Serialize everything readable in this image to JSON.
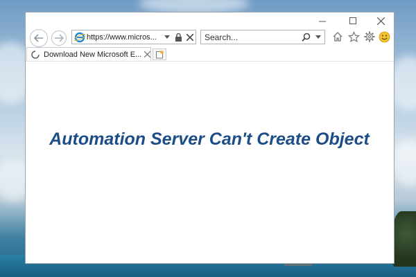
{
  "browser": {
    "address_url": "https://www.micros...",
    "search_placeholder": "Search...",
    "tab_title": "Download New Microsoft E..."
  },
  "content": {
    "headline": "Automation Server Can't Create Object"
  },
  "icons": [
    "minimize-icon",
    "maximize-icon",
    "close-icon",
    "back-icon",
    "forward-icon",
    "ie-logo-icon",
    "dropdown-icon",
    "lock-icon",
    "stop-icon",
    "search-icon",
    "home-icon",
    "favorites-star-icon",
    "settings-gear-icon",
    "smiley-feedback-icon",
    "loading-spinner-icon",
    "new-tab-icon"
  ],
  "colors": {
    "headline": "#1c4d86",
    "window_bg": "#ffffff",
    "smiley": "#f2c230",
    "ie_logo": "#1e88d8"
  }
}
